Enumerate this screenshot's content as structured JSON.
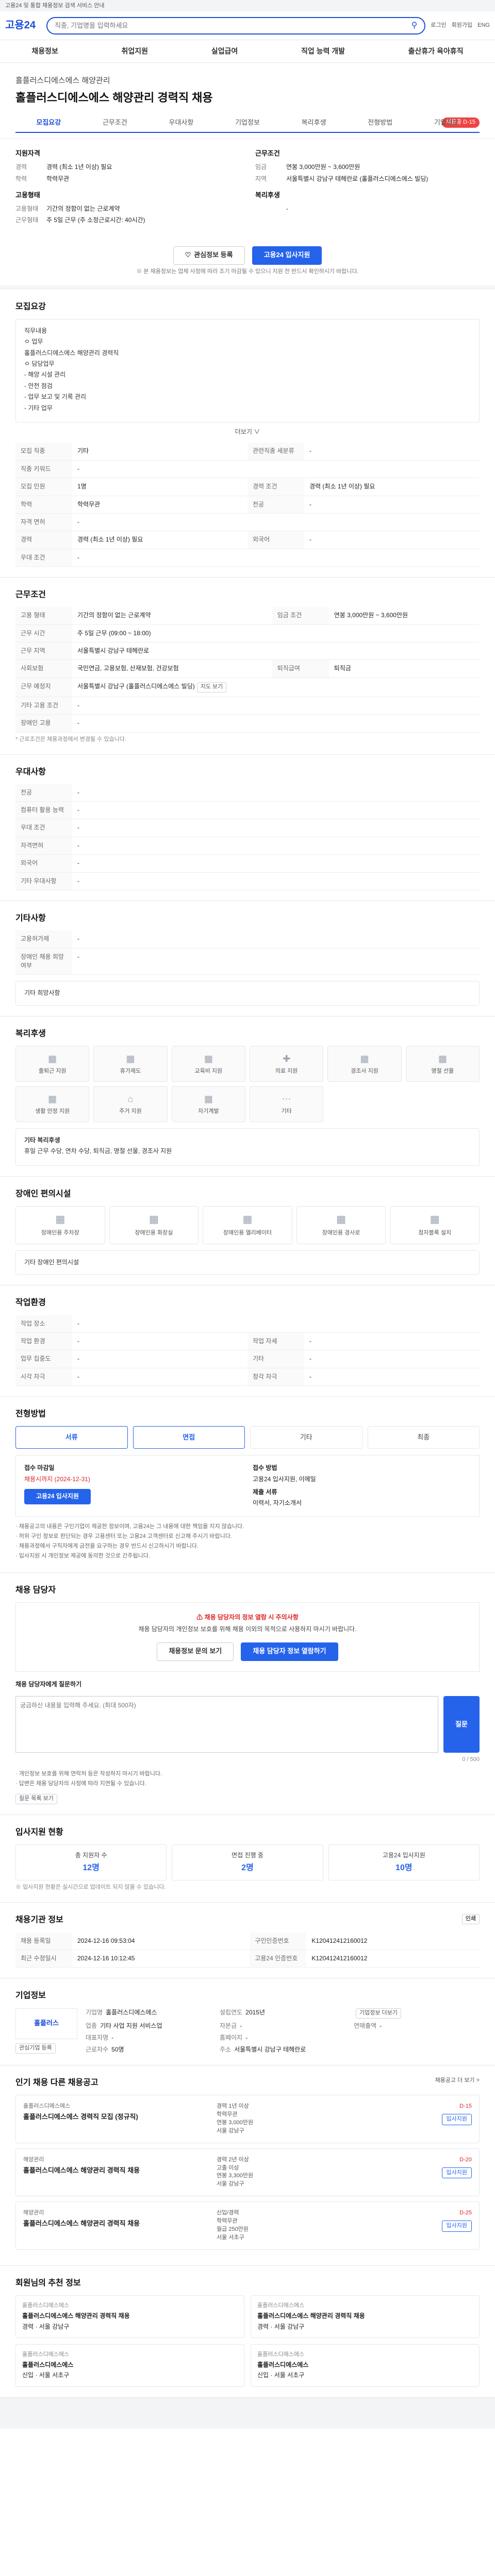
{
  "topnote": "고용24 및 통합 채용정보 검색 서비스 안내",
  "header": {
    "logo": "고용24",
    "search_placeholder": "직종, 기업명을 입력하세요",
    "util": [
      "로그인",
      "회원가입",
      "ENG"
    ]
  },
  "gnb": [
    "채용정보",
    "취업지원",
    "실업급여",
    "직업 능력 개발",
    "출산휴가 육아휴직"
  ],
  "job": {
    "company": "홀플러스디에스에스 해양관리",
    "title": "홀플러스디에스에스 해양관리 경력직 채용",
    "dday": "채용중 D-15",
    "tabs": [
      "모집요강",
      "근무조건",
      "우대사항",
      "기업정보",
      "복리후생",
      "전형방법",
      "기업정보"
    ]
  },
  "summary": {
    "left_title": "지원자격",
    "left": [
      {
        "k": "경력",
        "v": "경력 (최소 1년 이상) 필요"
      },
      {
        "k": "학력",
        "v": "학력무관"
      }
    ],
    "left2_title": "고용형태",
    "left2": [
      {
        "k": "고용형태",
        "v": "기간의 정함이 없는 근로계약"
      },
      {
        "k": "근무형태",
        "v": "주 5일 근무 (주 소정근로시간: 40시간)"
      }
    ],
    "right_title": "근무조건",
    "right": [
      {
        "k": "임금",
        "v": "연봉 3,000만원 ~ 3,600만원"
      },
      {
        "k": "지역",
        "v": "서울특별시 강남구 테헤란로 (홀플러스디에스에스 빌딩)"
      }
    ],
    "right2_title": "복리후생",
    "right2": [
      {
        "k": "",
        "v": "-"
      }
    ]
  },
  "actions": {
    "save": "관심정보 등록",
    "apply": "고용24 입사지원"
  },
  "notice": "※ 본 채용정보는 업체 사정에 따라 조기 마감될 수 있으니 지원 전 반드시 확인하시기 바랍니다.",
  "recruit": {
    "title": "모집요강",
    "box": [
      "직무내용",
      "ㅇ 업무",
      "홀플러스디에스에스 해양관리 경력직",
      "ㅇ 담당업무",
      "- 해양 시설 관리",
      "- 안전 점검",
      "- 업무 보고 및 기록 관리",
      "- 기타 업무"
    ],
    "more": "더보기 ∨",
    "rows": [
      {
        "k": "모집 직종",
        "v": "기타",
        "k2": "관련직종 세분류",
        "v2": "-"
      },
      {
        "k": "직종 키워드",
        "v": "-",
        "k2": "",
        "v2": ""
      },
      {
        "k": "모집 인원",
        "v": "1명",
        "k2": "경력 조건",
        "v2": "경력 (최소 1년 이상) 필요"
      },
      {
        "k": "학력",
        "v": "학력무관",
        "k2": "전공",
        "v2": "-"
      },
      {
        "k": "자격 면허",
        "v": "-",
        "k2": "",
        "v2": ""
      },
      {
        "k": "경력",
        "v": "경력 (최소 1년 이상) 필요",
        "k2": "외국어",
        "v2": "-"
      },
      {
        "k": "우대 조건",
        "v": "-",
        "k2": "",
        "v2": ""
      }
    ]
  },
  "work": {
    "title": "근무조건",
    "rows": [
      {
        "k": "고용 형태",
        "v": "기간의 정함이 없는 근로계약",
        "k2": "임금 조건",
        "v2": "연봉 3,000만원 ~ 3,600만원"
      },
      {
        "k": "근무 시간",
        "v": "주 5일 근무 (09:00 ~ 18:00)",
        "k2": "",
        "v2": ""
      },
      {
        "k": "근무 지역",
        "v": "서울특별시 강남구 테헤란로",
        "k2": "",
        "v2": ""
      },
      {
        "k": "사회보험",
        "v": "국민연금, 고용보험, 산재보험, 건강보험",
        "k2": "퇴직급여",
        "v2": "퇴직금"
      },
      {
        "k": "근무 예정지",
        "v": "서울특별시 강남구 (홀플러스디에스에스 빌딩)",
        "k2": "",
        "v2": ""
      },
      {
        "k": "기타 고용 조건",
        "v": "-",
        "k2": "",
        "v2": ""
      },
      {
        "k": "장애인 고용",
        "v": "-",
        "k2": "",
        "v2": ""
      }
    ],
    "map_btn": "지도 보기",
    "foot": "* 근로조건은 채용과정에서 변경될 수 있습니다."
  },
  "pref": {
    "title": "우대사항",
    "rows": [
      {
        "k": "전공",
        "v": "-"
      },
      {
        "k": "컴퓨터 활용 능력",
        "v": "-"
      },
      {
        "k": "우대 조건",
        "v": "-"
      },
      {
        "k": "자격면허",
        "v": "-"
      },
      {
        "k": "외국어",
        "v": "-"
      },
      {
        "k": "기타 우대사항",
        "v": "-"
      }
    ]
  },
  "etc": {
    "title": "기타사항",
    "rows": [
      {
        "k": "고용허가제",
        "v": "-"
      },
      {
        "k": "장애인 채용 희망 여부",
        "v": "-"
      }
    ],
    "link": "기타 희망사항"
  },
  "welfare": {
    "title": "복리후생",
    "items": [
      "출퇴근 지원",
      "휴가제도",
      "교육비 지원",
      "의료 지원",
      "경조사 지원",
      "명절 선물",
      "생활 안정 지원",
      "주거 지원",
      "자기계발",
      "기타"
    ],
    "etc_label": "기타 복리후생",
    "etc_value": "휴일 근무 수당, 연차 수당, 퇴직금, 명절 선물, 경조사 지원"
  },
  "disabled": {
    "title": "장애인 편의시설",
    "items": [
      "장애인용 주차장",
      "장애인용 화장실",
      "장애인용 엘리베이터",
      "장애인용 경사로",
      "점자블록 설치"
    ],
    "etc": "기타 장애인 편의시설"
  },
  "workenv": {
    "title": "작업환경",
    "rows": [
      {
        "k": "작업 장소",
        "v": "-",
        "k2": "",
        "v2": ""
      },
      {
        "k": "작업 환경",
        "v": "-",
        "k2": "작업 자세",
        "v2": "-"
      },
      {
        "k": "업무 집중도",
        "v": "-",
        "k2": "기타",
        "v2": "-"
      },
      {
        "k": "시각 자극",
        "v": "-",
        "k2": "청각 자극",
        "v2": "-"
      }
    ]
  },
  "selection": {
    "title": "전형방법",
    "steps": [
      "서류",
      "면접",
      "기타",
      "최종"
    ],
    "apply_title": "접수 마감일",
    "apply_value": "채용시까지 (2024-12-31)",
    "method_title": "접수 방법",
    "method_value": "고용24 입사지원, 이메일",
    "doc_title": "제출 서류",
    "doc_value": "이력서, 자기소개서",
    "apply_btn": "고용24 입사지원",
    "bullets": [
      "· 채용공고의 내용은 구인기업이 제공한 정보이며, 고용24는 그 내용에 대한 책임을 지지 않습니다.",
      "· 허위 구인 정보로 판단되는 경우 고용센터 또는 고용24 고객센터로 신고해 주시기 바랍니다.",
      "· 채용과정에서 구직자에게 금전을 요구하는 경우 반드시 신고하시기 바랍니다.",
      "· 입사지원 시 개인정보 제공에 동의한 것으로 간주됩니다."
    ]
  },
  "contact": {
    "title": "채용 담당자",
    "head": "채용 담당자의 정보 열람 시 주의사항",
    "body": "채용 담당자의 개인정보 보호를 위해 채용 이외의 목적으로 사용하지 마시기 바랍니다.",
    "btn1": "채용정보 문의 보기",
    "btn2": "채용 담당자 정보 열람하기",
    "qa_title": "채용 담당자에게 질문하기",
    "qa_placeholder": "궁금하신 내용을 입력해 주세요. (최대 500자)",
    "qa_btn": "질문",
    "qa_count": "0 / 500",
    "bullets": [
      "· 개인정보 보호를 위해 연락처 등은 작성하지 마시기 바랍니다.",
      "· 답변은 채용 담당자의 사정에 따라 지연될 수 있습니다."
    ],
    "qa_list": "질문 목록 보기"
  },
  "stats": {
    "title": "입사지원 현황",
    "items": [
      {
        "label": "총 지원자 수",
        "value": "12명"
      },
      {
        "label": "면접 진행 중",
        "value": "2명"
      },
      {
        "label": "고용24 입사지원",
        "value": "10명"
      }
    ],
    "foot": "※ 입사지원 현황은 실시간으로 업데이트 되지 않을 수 있습니다."
  },
  "meta": {
    "title": "채용기관 정보",
    "rows": [
      {
        "k": "채용 등록일",
        "v": "2024-12-16 09:53:04",
        "k2": "구인인증번호",
        "v2": "K120412412160012"
      },
      {
        "k": "최근 수정일시",
        "v": "2024-12-16 10:12:45",
        "k2": "고용24 인증번호",
        "v2": "K120412412160012"
      }
    ],
    "print_btn": "인쇄"
  },
  "company": {
    "title": "기업정보",
    "logo": "홀플러스",
    "rows": [
      {
        "k": "기업명",
        "v": "홀플러스디에스에스"
      },
      {
        "k": "업종",
        "v": "기타 사업 지원 서비스업"
      },
      {
        "k": "대표자명",
        "v": "-"
      },
      {
        "k": "근로자수",
        "v": "50명"
      },
      {
        "k": "설립연도",
        "v": "2015년"
      },
      {
        "k": "자본금",
        "v": "-"
      },
      {
        "k": "홈페이지",
        "v": "-"
      },
      {
        "k": "주소",
        "v": "서울특별시 강남구 테헤란로"
      },
      {
        "k": "연매출액",
        "v": "-"
      }
    ],
    "btn1": "관심기업 등록",
    "btn2": "기업정보 더보기"
  },
  "others": {
    "title": "인기 채용 다른 채용공고",
    "right_label": "채용공고 더 보기 >",
    "items": [
      {
        "company": "홀플러스디에스에스",
        "title": "홀플러스디에스에스 경력직 모집 (정규직)",
        "career": "경력 1년 이상",
        "edu": "학력무관",
        "pay": "연봉 3,000만원",
        "place": "서울 강남구",
        "deadline": "D-15",
        "btn": "입사지원"
      },
      {
        "company": "해양관리",
        "title": "홀플러스디에스에스 해양관리 경력직 채용",
        "career": "경력 2년 이상",
        "edu": "고졸 이상",
        "pay": "연봉 3,300만원",
        "place": "서울 강남구",
        "deadline": "D-20",
        "btn": "입사지원"
      },
      {
        "company": "해양관리",
        "title": "홀플러스디에스에스 해양관리 경력직 채용",
        "career": "신입/경력",
        "edu": "학력무관",
        "pay": "월급 250만원",
        "place": "서울 서초구",
        "deadline": "D-25",
        "btn": "입사지원"
      }
    ]
  },
  "recommend": {
    "title": "회원님의 추천 정보",
    "cards": [
      {
        "company": "홀플러스디에스에스",
        "title": "홀플러스디에스에스 해양관리 경력직 채용",
        "info": "경력 · 서울 강남구"
      },
      {
        "company": "홀플러스디에스에스",
        "title": "홀플러스디에스에스 해양관리 경력직 채용",
        "info": "경력 · 서울 강남구"
      },
      {
        "company": "홀플러스디에스에스",
        "title": "홀플러스디에스에스",
        "info": "신입 · 서울 서초구"
      },
      {
        "company": "홀플러스디에스에스",
        "title": "홀플러스디에스에스",
        "info": "신입 · 서울 서초구"
      }
    ]
  }
}
